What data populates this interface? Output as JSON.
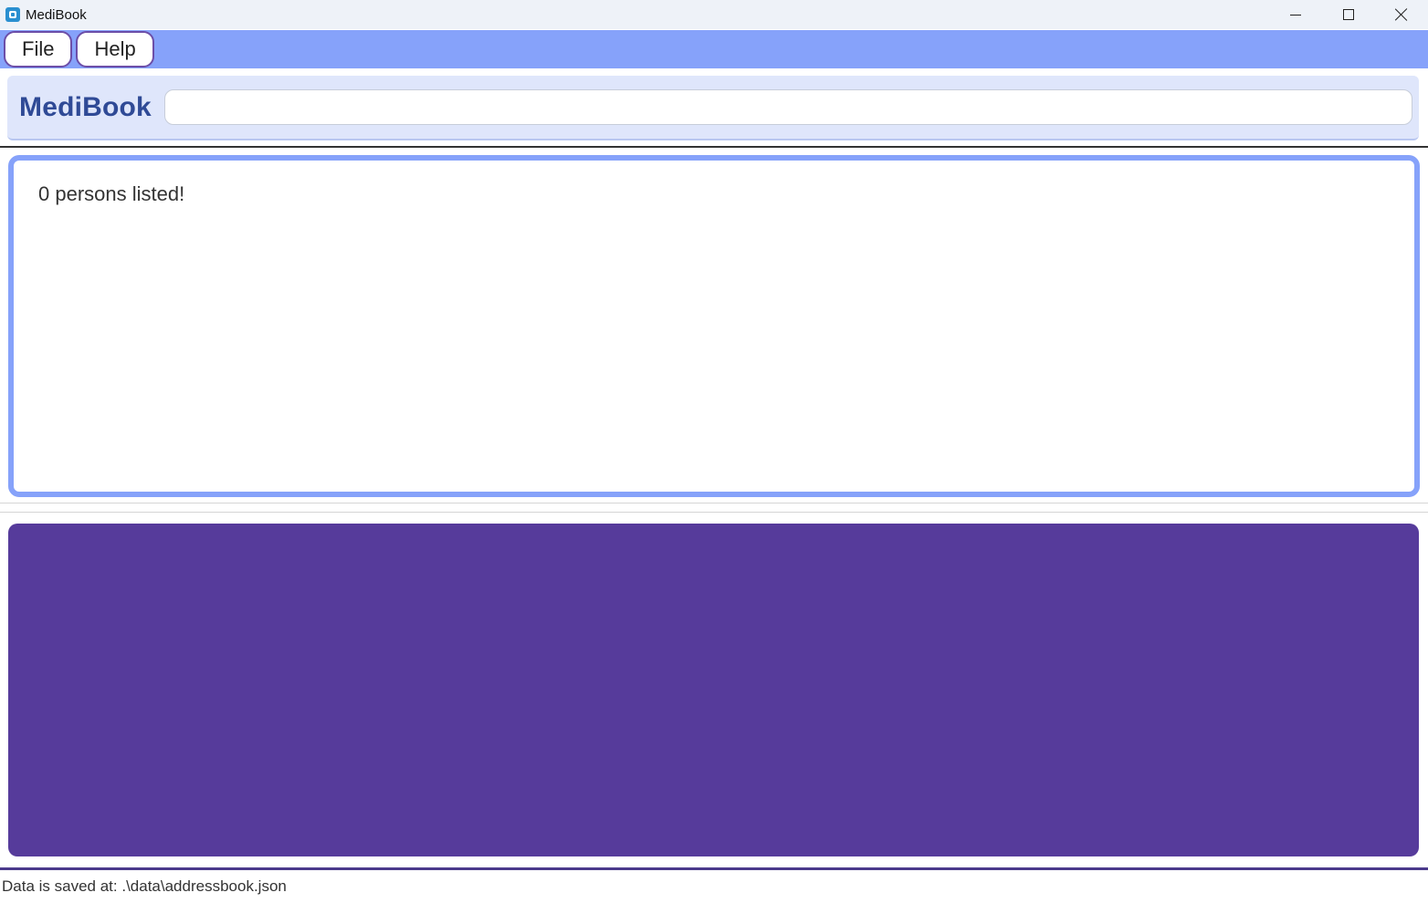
{
  "window": {
    "title": "MediBook",
    "icon": "medibook-app-icon",
    "controls": [
      "minimize-icon",
      "maximize-icon",
      "close-icon"
    ]
  },
  "menu": {
    "file_label": "File",
    "help_label": "Help"
  },
  "header": {
    "brand": "MediBook",
    "command_value": "",
    "command_placeholder": ""
  },
  "result": {
    "message": "0 persons listed!"
  },
  "person_list": {
    "items": []
  },
  "status": {
    "save_location": "Data is saved at: .\\data\\addressbook.json"
  },
  "colors": {
    "menubar": "#86a2fa",
    "accent_border": "#86a2fa",
    "list_panel": "#563b9b",
    "brand_text": "#2f4a96",
    "header_bg": "#dfe6fb"
  }
}
